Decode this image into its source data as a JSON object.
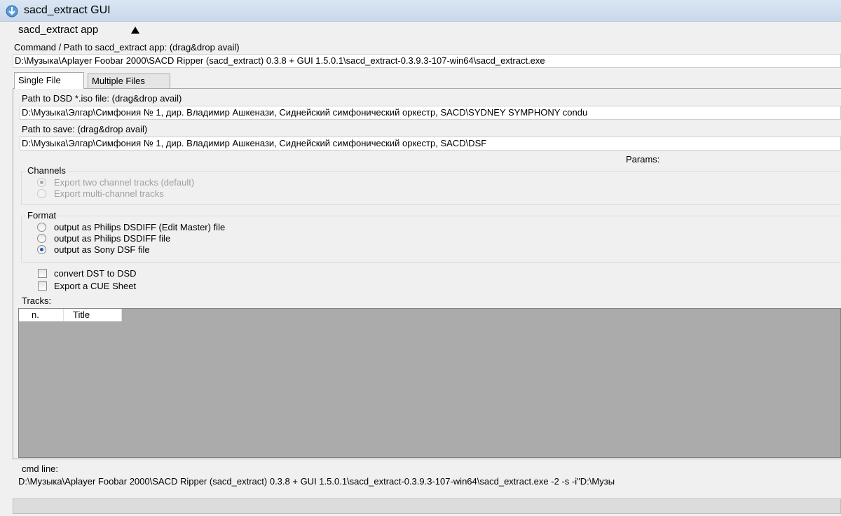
{
  "window": {
    "title": "sacd_extract GUI"
  },
  "app_section": {
    "label": "sacd_extract app",
    "toggle_icon": "triangle-up-icon",
    "cmd_label": "Command / Path to sacd_extract app: (drag&drop avail)",
    "cmd_path": "D:\\Музыка\\Aplayer Foobar 2000\\SACD Ripper (sacd_extract) 0.3.8 + GUI 1.5.0.1\\sacd_extract-0.3.9.3-107-win64\\sacd_extract.exe"
  },
  "tabs": [
    {
      "label": "Single File",
      "active": true
    },
    {
      "label": "Multiple Files",
      "active": false
    }
  ],
  "single_file": {
    "iso_label": "Path to DSD *.iso file: (drag&drop avail)",
    "iso_path": "D:\\Музыка\\Элгар\\Симфония № 1, дир. Владимир Ашкенази, Сиднейский симфонический оркестр, SACD\\SYDNEY SYMPHONY condu",
    "save_label": "Path to save: (drag&drop avail)",
    "save_path": "D:\\Музыка\\Элгар\\Симфония № 1, дир. Владимир Ашкенази, Сиднейский симфонический оркестр, SACD\\DSF",
    "params_label": "Params:",
    "channels": {
      "title": "Channels",
      "options": [
        {
          "label": "Export two channel tracks (default)",
          "checked": true,
          "enabled": false
        },
        {
          "label": "Export multi-channel tracks",
          "checked": false,
          "enabled": false
        }
      ]
    },
    "format": {
      "title": "Format",
      "options": [
        {
          "label": "output as Philips DSDIFF (Edit Master) file",
          "checked": false
        },
        {
          "label": "output as Philips DSDIFF file",
          "checked": false
        },
        {
          "label": "output as Sony DSF file",
          "checked": true
        }
      ]
    },
    "checkboxes": [
      {
        "label": "convert DST to DSD",
        "checked": false
      },
      {
        "label": "Export a CUE Sheet",
        "checked": false
      }
    ],
    "tracks": {
      "label": "Tracks:",
      "columns": [
        "n.",
        "Title"
      ]
    },
    "cmd_line_label": "cmd line:",
    "cmd_line": "D:\\Музыка\\Aplayer Foobar 2000\\SACD Ripper (sacd_extract) 0.3.8 + GUI 1.5.0.1\\sacd_extract-0.3.9.3-107-win64\\sacd_extract.exe -2 -s  -i\"D:\\Музы"
  },
  "colors": {
    "accent": "#1a5eb4",
    "list_bg": "#ababab",
    "window_bg": "#f0f0f0"
  }
}
